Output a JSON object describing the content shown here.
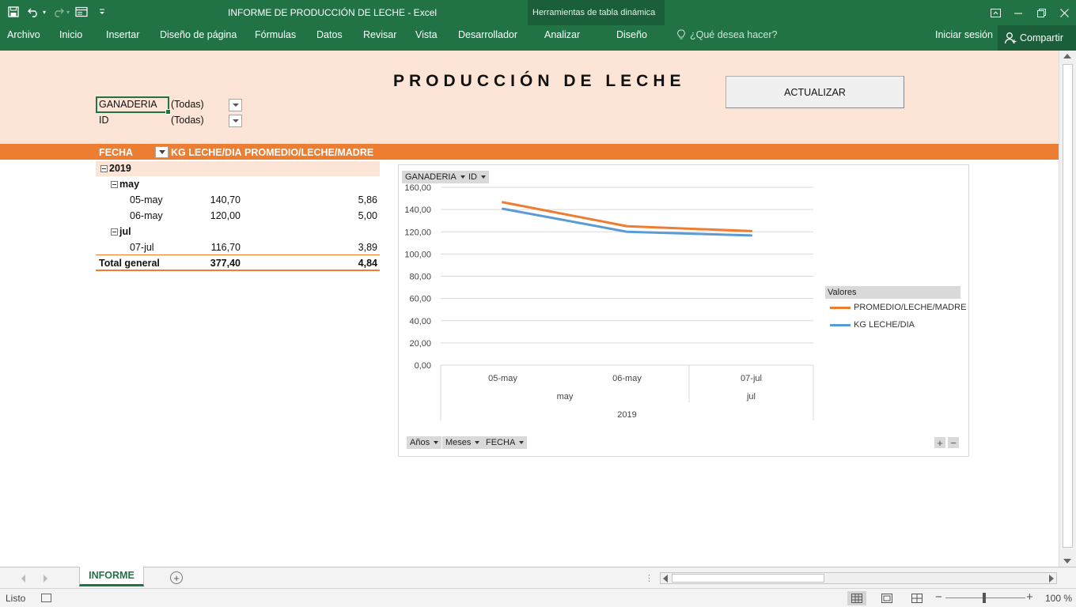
{
  "window": {
    "title": "INFORME DE PRODUCCIÓN DE LECHE - Excel",
    "context_tools_label": "Herramientas de tabla dinámica"
  },
  "ribbon": {
    "tabs": [
      {
        "label": "Archivo"
      },
      {
        "label": "Inicio"
      },
      {
        "label": "Insertar"
      },
      {
        "label": "Diseño de página"
      },
      {
        "label": "Fórmulas"
      },
      {
        "label": "Datos"
      },
      {
        "label": "Revisar"
      },
      {
        "label": "Vista"
      },
      {
        "label": "Desarrollador"
      },
      {
        "label": "Analizar"
      },
      {
        "label": "Diseño"
      }
    ],
    "tell_me": "¿Qué desea hacer?",
    "sign_in": "Iniciar sesión",
    "share": "Compartir"
  },
  "report": {
    "title": "PRODUCCIÓN DE LECHE",
    "update_button": "ACTUALIZAR",
    "filters": [
      {
        "field": "GANADERIA",
        "value": "(Todas)"
      },
      {
        "field": "ID",
        "value": "(Todas)"
      }
    ]
  },
  "pivot": {
    "headers": [
      "FECHA",
      "KG LECHE/DIA",
      "PROMEDIO/LECHE/MADRE"
    ],
    "year": "2019",
    "groups": [
      {
        "month": "may",
        "rows": [
          {
            "date": "05-may",
            "kg": "140,70",
            "avg": "5,86"
          },
          {
            "date": "06-may",
            "kg": "120,00",
            "avg": "5,00"
          }
        ]
      },
      {
        "month": "jul",
        "rows": [
          {
            "date": "07-jul",
            "kg": "116,70",
            "avg": "3,89"
          }
        ]
      }
    ],
    "total": {
      "label": "Total general",
      "kg": "377,40",
      "avg": "4,84"
    }
  },
  "chart_data": {
    "type": "line",
    "filter_buttons": [
      "GANADERIA",
      "ID"
    ],
    "axis_buttons": [
      "Años",
      "Meses",
      "FECHA"
    ],
    "categories": [
      "05-may",
      "06-may",
      "07-jul"
    ],
    "month_groups": [
      {
        "label": "may",
        "span": 2
      },
      {
        "label": "jul",
        "span": 1
      }
    ],
    "year_groups": [
      {
        "label": "2019",
        "span": 3
      }
    ],
    "y_ticks": [
      "0,00",
      "20,00",
      "40,00",
      "60,00",
      "80,00",
      "100,00",
      "120,00",
      "140,00",
      "160,00"
    ],
    "ylim": [
      0,
      160
    ],
    "legend_title": "Valores",
    "legend_position": "right",
    "grid": true,
    "series": [
      {
        "name": "PROMEDIO/LECHE/MADRE",
        "color": "#ed7d31",
        "values": [
          146.56,
          125.0,
          120.59
        ]
      },
      {
        "name": "KG LECHE/DIA",
        "color": "#5b9bd5",
        "values": [
          140.7,
          120.0,
          116.7
        ]
      }
    ]
  },
  "sheets": {
    "active": "INFORME"
  },
  "status": {
    "ready": "Listo",
    "zoom": "100 %"
  }
}
